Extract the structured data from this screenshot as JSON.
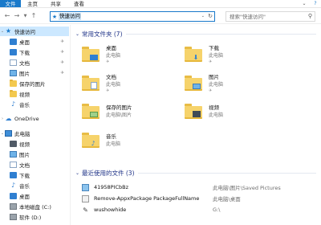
{
  "ribbon": {
    "tabs": [
      "文件",
      "主页",
      "共享",
      "查看"
    ],
    "right_icons": [
      "chevron-down-icon",
      "help-icon"
    ]
  },
  "nav": {
    "address_path": "快速访问",
    "search_placeholder": "搜索\"快速访问\""
  },
  "sidebar": {
    "items": [
      {
        "label": "快速访问",
        "icon": "star-icon",
        "pinned": false
      },
      {
        "label": "桌面",
        "icon": "desktop-icon",
        "pinned": true
      },
      {
        "label": "下载",
        "icon": "download-icon",
        "pinned": true
      },
      {
        "label": "文档",
        "icon": "documents-icon",
        "pinned": true
      },
      {
        "label": "图片",
        "icon": "pictures-icon",
        "pinned": true
      },
      {
        "label": "保存的图片",
        "icon": "folder-icon",
        "pinned": false
      },
      {
        "label": "视频",
        "icon": "folder-icon",
        "pinned": false
      },
      {
        "label": "音乐",
        "icon": "music-icon",
        "pinned": false
      },
      {
        "label": "OneDrive",
        "icon": "onedrive-icon",
        "pinned": false
      },
      {
        "label": "此电脑",
        "icon": "computer-icon",
        "pinned": false
      },
      {
        "label": "视频",
        "icon": "videos-icon",
        "pinned": false
      },
      {
        "label": "图片",
        "icon": "pictures-icon",
        "pinned": false
      },
      {
        "label": "文档",
        "icon": "documents-icon",
        "pinned": false
      },
      {
        "label": "下载",
        "icon": "download-icon",
        "pinned": false
      },
      {
        "label": "音乐",
        "icon": "music-icon",
        "pinned": false
      },
      {
        "label": "桌面",
        "icon": "desktop-icon",
        "pinned": false
      },
      {
        "label": "本地磁盘 (C:)",
        "icon": "drive-icon",
        "pinned": false
      },
      {
        "label": "软件 (D:)",
        "icon": "drive-icon",
        "pinned": false
      }
    ]
  },
  "frequent": {
    "title": "常用文件夹 (7)",
    "folders": [
      {
        "name": "桌面",
        "location": "此电脑"
      },
      {
        "name": "下载",
        "location": "此电脑"
      },
      {
        "name": "文档",
        "location": "此电脑"
      },
      {
        "name": "图片",
        "location": "此电脑"
      },
      {
        "name": "保存的图片",
        "location": "此电脑\\图片"
      },
      {
        "name": "视频",
        "location": "此电脑"
      },
      {
        "name": "音乐",
        "location": "此电脑"
      }
    ]
  },
  "recent": {
    "title": "最近使用的文件 (3)",
    "files": [
      {
        "name": "41958PICbBz",
        "path": "此电脑\\图片\\Saved Pictures"
      },
      {
        "name": "Remove-AppxPackage PackageFullName",
        "path": "此电脑\\桌面"
      },
      {
        "name": "wushowhide",
        "path": "G:\\"
      }
    ]
  },
  "colors": {
    "accent": "#1979ca",
    "selection": "#cce8ff",
    "section_header": "#1e3287",
    "folder": "#f6d36b"
  }
}
